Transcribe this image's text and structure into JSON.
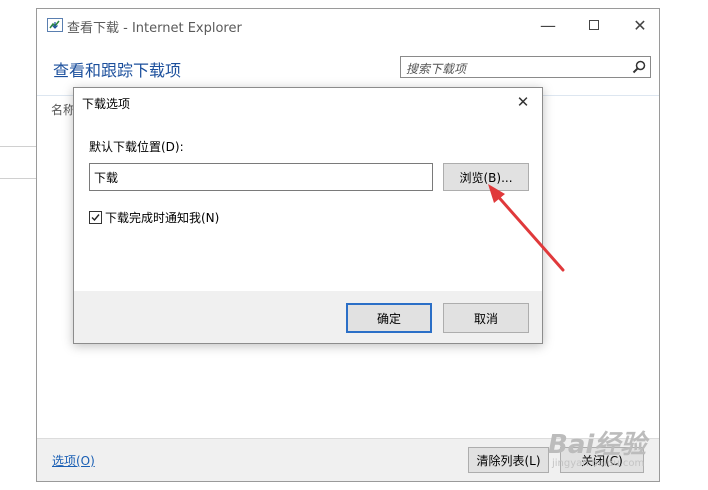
{
  "ie_window": {
    "title": "查看下载 - Internet Explorer",
    "header_title": "查看和跟踪下载项",
    "search_placeholder": "搜索下载项",
    "column_name": "名称",
    "options_link": "选项(O)",
    "clear_list_button": "清除列表(L)",
    "close_button": "关闭(C)"
  },
  "dialog": {
    "title": "下载选项",
    "location_label": "默认下载位置(D):",
    "location_value": "下载",
    "browse_button": "浏览(B)...",
    "notify_label": "下载完成时通知我(N)",
    "notify_checked": true,
    "ok_button": "确定",
    "cancel_button": "取消"
  },
  "watermark": {
    "brand": "Bai经验",
    "url": "jingyan.baidu.com"
  },
  "colors": {
    "accent_blue": "#1b4f9c",
    "link_blue": "#1a5fb4",
    "primary_border": "#2b6fc7",
    "annotation_red": "#e0393b"
  },
  "icons": [
    "ie-app-icon",
    "search-icon",
    "minimize-icon",
    "maximize-icon",
    "close-icon",
    "check-icon"
  ]
}
